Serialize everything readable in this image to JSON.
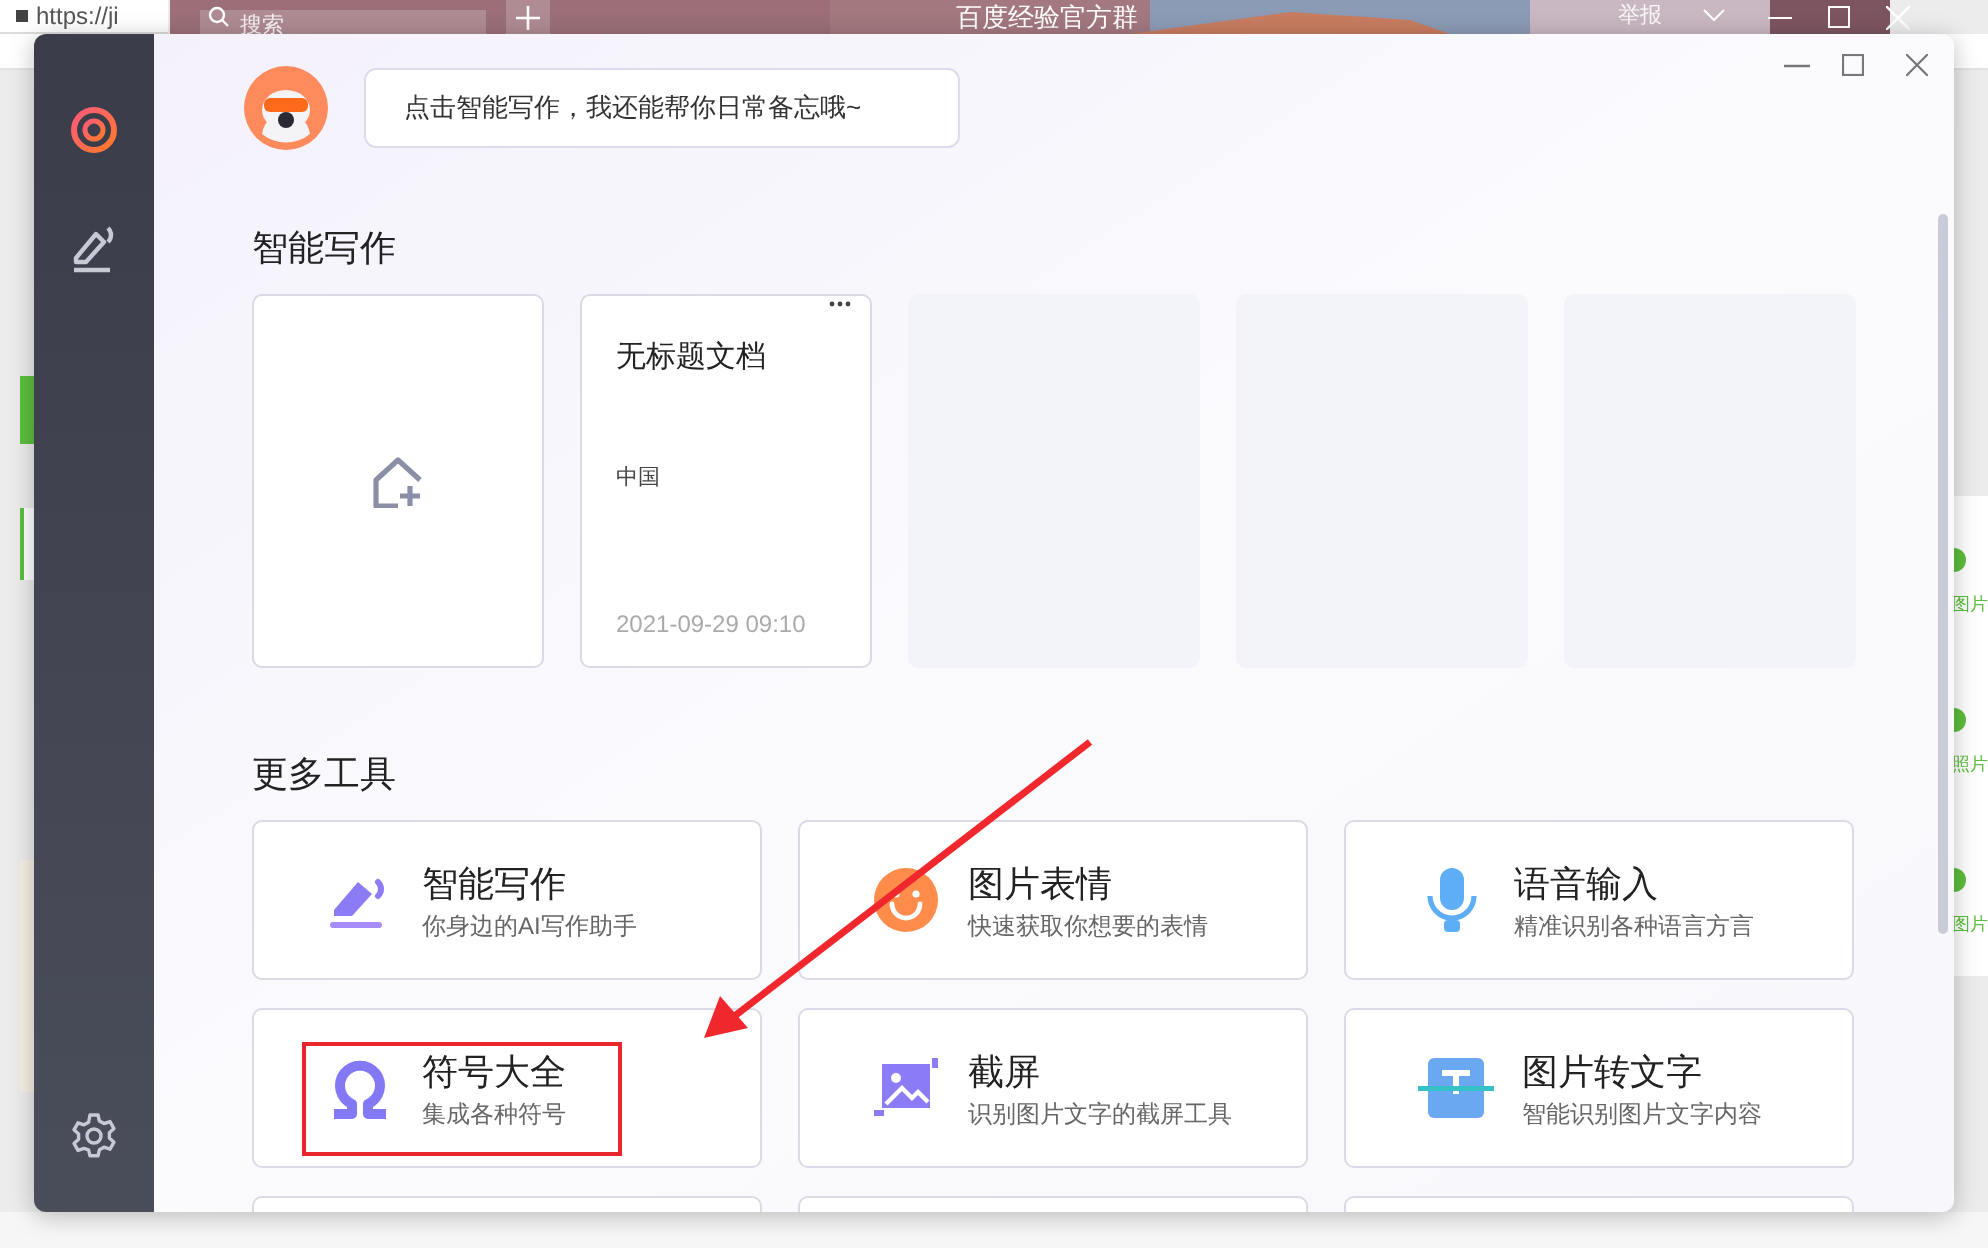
{
  "browser": {
    "address": "https://ji",
    "search_placeholder": "搜索",
    "banner_text": "百度经验官方群",
    "report_label": "举报",
    "side_items": [
      {
        "label": "图片"
      },
      {
        "label": "照片"
      },
      {
        "label": "图片"
      }
    ]
  },
  "assistant": {
    "message": "点击智能写作，我还能帮你日常备忘哦~"
  },
  "writing": {
    "title": "智能写作",
    "documents": [
      {
        "kind": "new"
      },
      {
        "kind": "doc",
        "title": "无标题文档",
        "excerpt": "中国",
        "date": "2021-09-29 09:10"
      },
      {
        "kind": "empty"
      },
      {
        "kind": "empty"
      },
      {
        "kind": "empty"
      }
    ]
  },
  "tools": {
    "title": "更多工具",
    "items": [
      {
        "kind": "pen",
        "title": "智能写作",
        "subtitle": "你身边的AI写作助手",
        "annotated": false
      },
      {
        "kind": "emoji",
        "title": "图片表情",
        "subtitle": "快速获取你想要的表情",
        "annotated": false
      },
      {
        "kind": "mic",
        "title": "语音输入",
        "subtitle": "精准识别各种语言方言",
        "annotated": false
      },
      {
        "kind": "omega",
        "title": "符号大全",
        "subtitle": "集成各种符号",
        "annotated": true
      },
      {
        "kind": "crop",
        "title": "截屏",
        "subtitle": "识别图片文字的截屏工具",
        "annotated": false
      },
      {
        "kind": "ocr",
        "title": "图片转文字",
        "subtitle": "智能识别图片文字内容",
        "annotated": false
      },
      {
        "kind": "blank"
      },
      {
        "kind": "blank"
      },
      {
        "kind": "blank"
      }
    ]
  }
}
